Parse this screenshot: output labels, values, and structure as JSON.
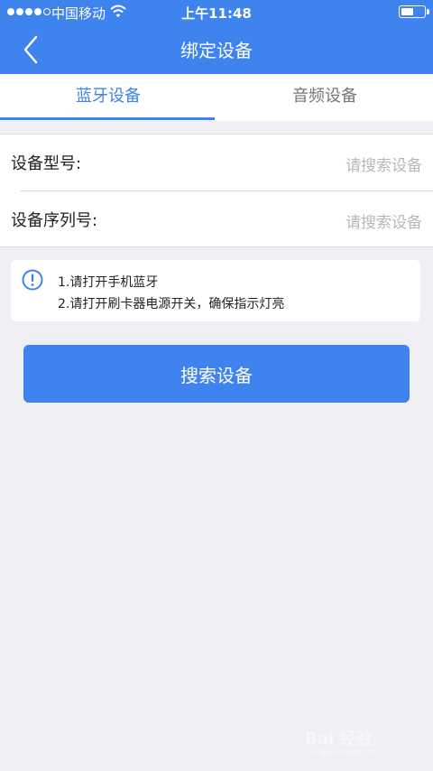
{
  "status_bar": {
    "carrier": "中国移动",
    "time": "上午11:48",
    "signal_bars_filled": 4,
    "signal_bars_total": 5,
    "battery_level": 0.45
  },
  "nav": {
    "title": "绑定设备",
    "back_icon": "chevron-left-icon"
  },
  "tabs": [
    {
      "label": "蓝牙设备",
      "active": true
    },
    {
      "label": "音频设备",
      "active": false
    }
  ],
  "form": {
    "model_label": "设备型号:",
    "model_placeholder": "请搜索设备",
    "serial_label": "设备序列号:",
    "serial_placeholder": "请搜索设备"
  },
  "tips": {
    "icon": "info-icon",
    "line1": "1.请打开手机蓝牙",
    "line2": "2.请打开刷卡器电源开关，确保指示灯亮"
  },
  "search_button": {
    "label": "搜索设备"
  },
  "watermark": {
    "text": "Bai  经验",
    "sub": "jingyan.baidu.com"
  },
  "colors": {
    "accent": "#3f83ee",
    "background": "#efeff4",
    "placeholder": "#b8b8b8"
  }
}
